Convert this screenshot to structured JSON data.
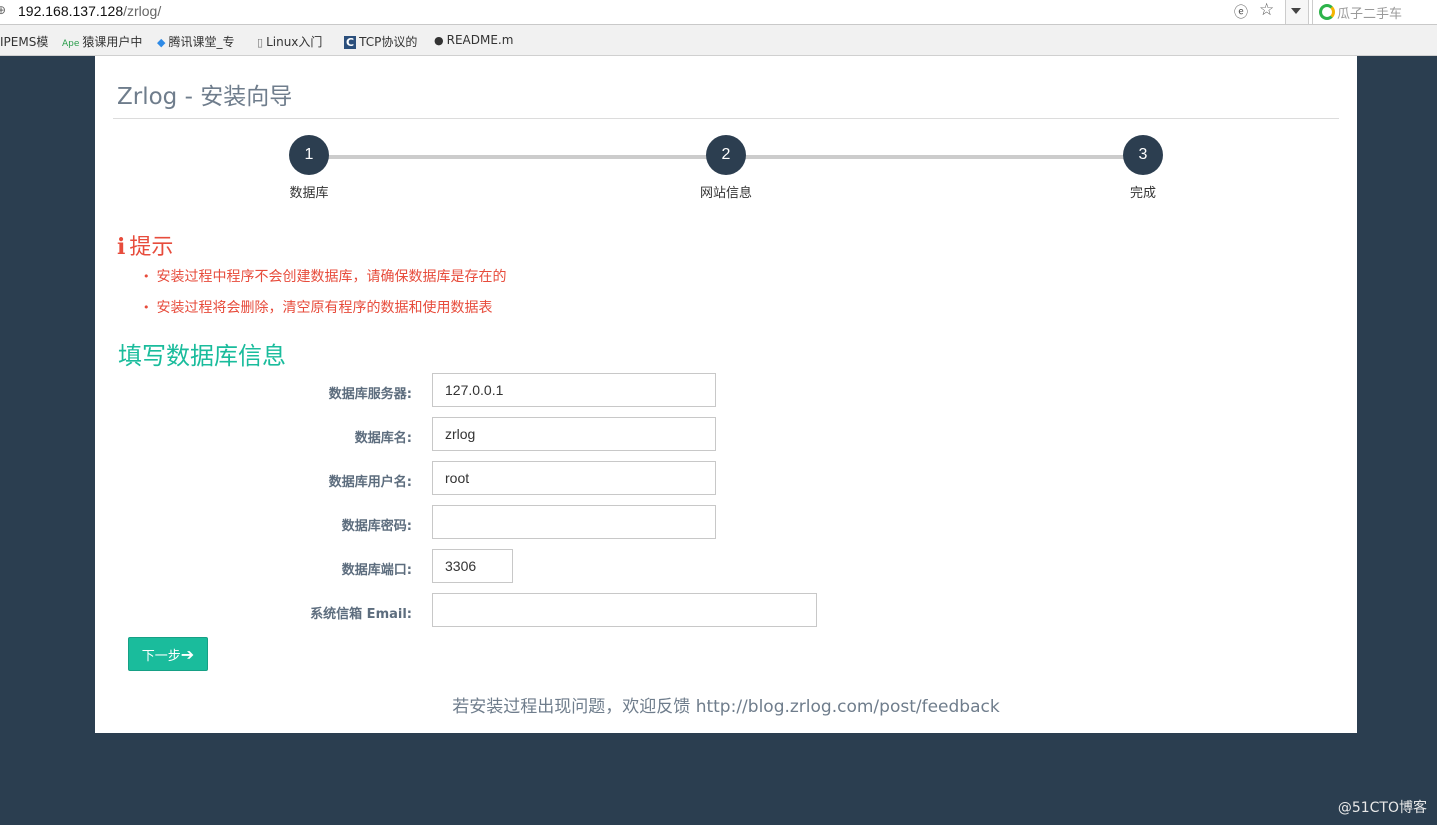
{
  "browser": {
    "url_host": "192.168.137.128",
    "url_path": "/zrlog/",
    "search_placeholder": "瓜子二手车",
    "bookmarks": [
      {
        "label": "IPEMS模",
        "icon": "page-icon"
      },
      {
        "label": "猿课用户中",
        "icon": "ape-icon"
      },
      {
        "label": "腾讯课堂_专",
        "icon": "tencent-icon"
      },
      {
        "label": "Linux入门",
        "icon": "page-icon"
      },
      {
        "label": "TCP协议的",
        "icon": "c-icon"
      },
      {
        "label": "README.m",
        "icon": "github-icon"
      }
    ]
  },
  "page": {
    "title": "Zrlog - 安装向导",
    "steps": [
      {
        "number": "1",
        "label": "数据库"
      },
      {
        "number": "2",
        "label": "网站信息"
      },
      {
        "number": "3",
        "label": "完成"
      }
    ],
    "tip": {
      "title": "提示",
      "items": [
        "安装过程中程序不会创建数据库，请确保数据库是存在的",
        "安装过程将会删除，清空原有程序的数据和使用数据表"
      ]
    },
    "section_title": "填写数据库信息",
    "form": {
      "host": {
        "label": "数据库服务器:",
        "value": "127.0.0.1"
      },
      "db_name": {
        "label": "数据库名:",
        "value": "zrlog"
      },
      "user": {
        "label": "数据库用户名:",
        "value": "root"
      },
      "password": {
        "label": "数据库密码:",
        "value": ""
      },
      "port": {
        "label": "数据库端口:",
        "value": "3306"
      },
      "email": {
        "label": "系统信箱 Email:",
        "value": ""
      }
    },
    "next_label": "下一步",
    "footer": "若安装过程出现问题，欢迎反馈 http://blog.zrlog.com/post/feedback"
  },
  "watermark": "@51CTO博客",
  "colors": {
    "background": "#2b3e50",
    "step_circle": "#2c3e50",
    "tip_red": "#e74c3c",
    "accent_green": "#1abc9c"
  }
}
